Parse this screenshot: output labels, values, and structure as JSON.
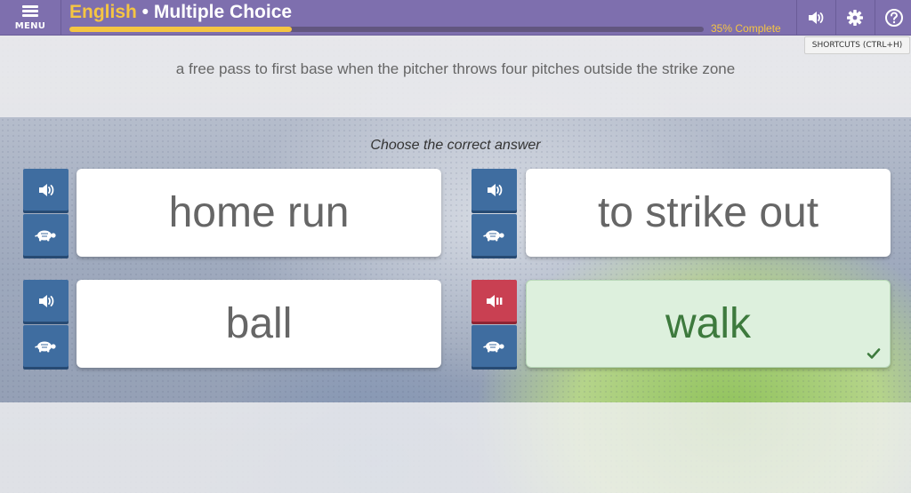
{
  "header": {
    "menu_label": "MENU",
    "title_lang": "English",
    "title_sep": " • ",
    "title_mode": "Multiple Choice",
    "progress_fraction": 0.35,
    "progress_text": "35% Complete",
    "icons": [
      "volume-icon",
      "gear-icon",
      "help-icon"
    ],
    "accent_color": "#f5c542",
    "bar_color": "#7e6fae"
  },
  "tooltip": "SHORTCUTS (CTRL+H)",
  "prompt": "a free pass to first base when the pitcher throws four pitches outside the strike zone",
  "instruction": "Choose the correct answer",
  "answers": [
    {
      "text": "home run"
    },
    {
      "text": "to strike out"
    },
    {
      "text": "ball"
    },
    {
      "text": "walk",
      "state": "correct",
      "audio_playing": true
    }
  ],
  "colors": {
    "audio_button": "#3f6da0",
    "audio_button_active": "#c94052",
    "correct_card": "#ddf0dd",
    "correct_text": "#3d7a3d"
  }
}
